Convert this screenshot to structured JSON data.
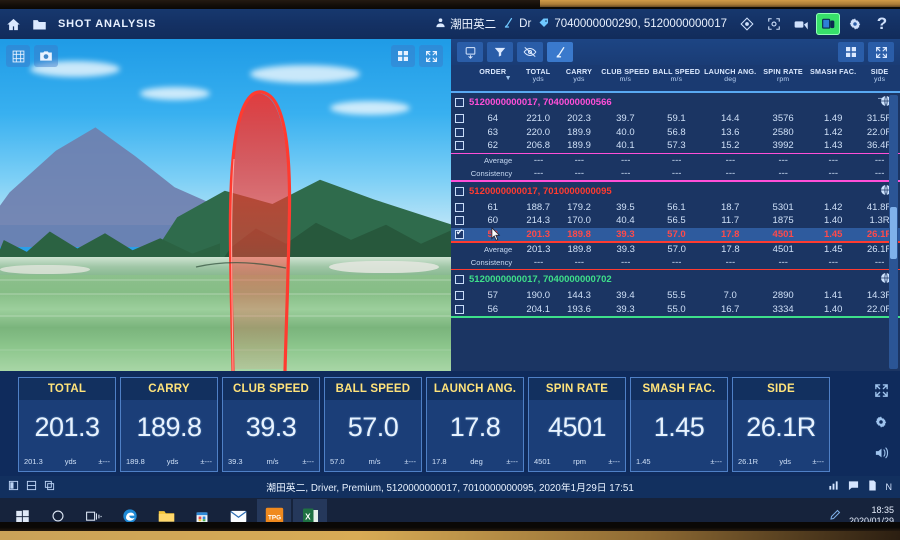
{
  "titlebar": {
    "app_title": "SHOT ANALYSIS",
    "home_icon": "home-icon",
    "folder_icon": "folder-icon",
    "player_icon": "person-icon",
    "player_name": "潮田英二",
    "club_icon": "golf-club-icon",
    "club_name": "Dr",
    "tag_icon": "tag-icon",
    "device_ids": "7040000000290, 5120000000017",
    "right_icons": [
      {
        "name": "calibrate-target-icon",
        "glyph": "target"
      },
      {
        "name": "detect-frame-icon",
        "glyph": "frame"
      },
      {
        "name": "video-camera-icon",
        "glyph": "camera"
      },
      {
        "name": "device-connect-icon",
        "glyph": "device",
        "active": true
      },
      {
        "name": "settings-gear-icon",
        "glyph": "gear"
      },
      {
        "name": "help-icon",
        "glyph": "?"
      }
    ]
  },
  "simulator": {
    "left_tools": [
      {
        "name": "grid-overlay-icon",
        "glyph": "grid"
      },
      {
        "name": "camera-snapshot-icon",
        "glyph": "camera"
      }
    ],
    "right_tools": [
      {
        "name": "layout-grid-icon",
        "glyph": "tiles"
      },
      {
        "name": "fullscreen-icon",
        "glyph": "expand"
      }
    ],
    "trajectory_color": "#ff3b30"
  },
  "toolstrip": [
    {
      "name": "save-shots-button",
      "glyph": "save",
      "selected": false
    },
    {
      "name": "filter-button",
      "glyph": "filter",
      "selected": false
    },
    {
      "name": "hide-shot-button",
      "glyph": "eye-off",
      "selected": false
    },
    {
      "name": "club-filter-button",
      "glyph": "club",
      "selected": true
    },
    {
      "name": "grid-view-button",
      "glyph": "tiles",
      "selected": false
    },
    {
      "name": "expand-table-button",
      "glyph": "expand",
      "selected": false
    }
  ],
  "table": {
    "columns": [
      {
        "label": "ORDER",
        "unit": ""
      },
      {
        "label": "TOTAL",
        "unit": "yds"
      },
      {
        "label": "CARRY",
        "unit": "yds"
      },
      {
        "label": "CLUB SPEED",
        "unit": "m/s"
      },
      {
        "label": "BALL SPEED",
        "unit": "m/s"
      },
      {
        "label": "LAUNCH ANG.",
        "unit": "deg"
      },
      {
        "label": "SPIN RATE",
        "unit": "rpm"
      },
      {
        "label": "SMASH FAC.",
        "unit": ""
      },
      {
        "label": "SIDE",
        "unit": "yds"
      }
    ],
    "sort_caret": "▼",
    "stat_labels": {
      "average": "Average",
      "consistency": "Consistency"
    },
    "empty_value": "---",
    "groups": [
      {
        "title": "5120000000017, 7040000000566",
        "color": "#ff4fd8",
        "rows": [
          {
            "order": "64",
            "total": "221.0",
            "carry": "202.3",
            "club_speed": "39.7",
            "ball_speed": "59.1",
            "launch_angle": "14.4",
            "spin_rate": "3576",
            "smash": "1.49",
            "side": "31.5R",
            "selected": false
          },
          {
            "order": "63",
            "total": "220.0",
            "carry": "189.9",
            "club_speed": "40.0",
            "ball_speed": "56.8",
            "launch_angle": "13.6",
            "spin_rate": "2580",
            "smash": "1.42",
            "side": "22.0R",
            "selected": false
          },
          {
            "order": "62",
            "total": "206.8",
            "carry": "189.9",
            "club_speed": "40.1",
            "ball_speed": "57.3",
            "launch_angle": "15.2",
            "spin_rate": "3992",
            "smash": "1.43",
            "side": "36.4R",
            "selected": false
          }
        ],
        "average": {
          "total": "---",
          "carry": "---",
          "club_speed": "---",
          "ball_speed": "---",
          "launch_angle": "---",
          "spin_rate": "---",
          "smash": "---",
          "side": "---"
        },
        "consistency": {
          "total": "---",
          "carry": "---",
          "club_speed": "---",
          "ball_speed": "---",
          "launch_angle": "---",
          "spin_rate": "---",
          "smash": "---",
          "side": "---"
        }
      },
      {
        "title": "5120000000017, 7010000000095",
        "color": "#ff3b30",
        "rows": [
          {
            "order": "61",
            "total": "188.7",
            "carry": "179.2",
            "club_speed": "39.5",
            "ball_speed": "56.1",
            "launch_angle": "18.7",
            "spin_rate": "5301",
            "smash": "1.42",
            "side": "41.8R",
            "selected": false
          },
          {
            "order": "60",
            "total": "214.3",
            "carry": "170.0",
            "club_speed": "40.4",
            "ball_speed": "56.5",
            "launch_angle": "11.7",
            "spin_rate": "1875",
            "smash": "1.40",
            "side": "1.3R",
            "selected": false
          },
          {
            "order": "59",
            "total": "201.3",
            "carry": "189.8",
            "club_speed": "39.3",
            "ball_speed": "57.0",
            "launch_angle": "17.8",
            "spin_rate": "4501",
            "smash": "1.45",
            "side": "26.1R",
            "selected": true
          }
        ],
        "average": {
          "total": "201.3",
          "carry": "189.8",
          "club_speed": "39.3",
          "ball_speed": "57.0",
          "launch_angle": "17.8",
          "spin_rate": "4501",
          "smash": "1.45",
          "side": "26.1R"
        },
        "consistency": {
          "total": "---",
          "carry": "---",
          "club_speed": "---",
          "ball_speed": "---",
          "launch_angle": "---",
          "spin_rate": "---",
          "smash": "---",
          "side": "---"
        }
      },
      {
        "title": "5120000000017, 7040000000702",
        "color": "#3ee08a",
        "rows": [
          {
            "order": "57",
            "total": "190.0",
            "carry": "144.3",
            "club_speed": "39.4",
            "ball_speed": "55.5",
            "launch_angle": "7.0",
            "spin_rate": "2890",
            "smash": "1.41",
            "side": "14.3R",
            "selected": false
          },
          {
            "order": "56",
            "total": "204.1",
            "carry": "193.6",
            "club_speed": "39.3",
            "ball_speed": "55.0",
            "launch_angle": "16.7",
            "spin_rate": "3334",
            "smash": "1.40",
            "side": "22.0R",
            "selected": false
          }
        ],
        "average": null,
        "consistency": null
      }
    ]
  },
  "metrics": [
    {
      "label": "TOTAL",
      "value": "201.3",
      "sub": "201.3",
      "unit": "yds",
      "tolerance": "±---"
    },
    {
      "label": "CARRY",
      "value": "189.8",
      "sub": "189.8",
      "unit": "yds",
      "tolerance": "±---"
    },
    {
      "label": "CLUB SPEED",
      "value": "39.3",
      "sub": "39.3",
      "unit": "m/s",
      "tolerance": "±---"
    },
    {
      "label": "BALL SPEED",
      "value": "57.0",
      "sub": "57.0",
      "unit": "m/s",
      "tolerance": "±---"
    },
    {
      "label": "LAUNCH ANG.",
      "value": "17.8",
      "sub": "17.8",
      "unit": "deg",
      "tolerance": "±---"
    },
    {
      "label": "SPIN RATE",
      "value": "4501",
      "sub": "4501",
      "unit": "rpm",
      "tolerance": "±---"
    },
    {
      "label": "SMASH FAC.",
      "value": "1.45",
      "sub": "1.45",
      "unit": "",
      "tolerance": "±---"
    },
    {
      "label": "SIDE",
      "value": "26.1R",
      "sub": "26.1R",
      "unit": "yds",
      "tolerance": "±---"
    }
  ],
  "metric_side_tools": [
    {
      "name": "fullscreen-icon"
    },
    {
      "name": "settings-gear-icon"
    },
    {
      "name": "volume-icon"
    }
  ],
  "statusbar": {
    "left_icons": [
      {
        "name": "single-view-icon"
      },
      {
        "name": "split-view-icon"
      },
      {
        "name": "copy-view-icon"
      }
    ],
    "summary": "潮田英二, Driver, Premium, 5120000000017, 7010000000095, 2020年1月29日 17:51",
    "right_icons": [
      {
        "name": "stats-chart-icon"
      },
      {
        "name": "message-icon"
      },
      {
        "name": "document-icon"
      },
      {
        "name": "network-icon",
        "label": "N"
      }
    ]
  },
  "taskbar": {
    "items": [
      {
        "name": "start-button",
        "glyph": "windows"
      },
      {
        "name": "cortana-search-icon",
        "glyph": "circle"
      },
      {
        "name": "task-view-icon",
        "glyph": "taskview"
      },
      {
        "name": "edge-browser-icon",
        "glyph": "e"
      },
      {
        "name": "file-explorer-icon",
        "glyph": "folder"
      },
      {
        "name": "microsoft-store-icon",
        "glyph": "store"
      },
      {
        "name": "mail-icon",
        "glyph": "mail"
      },
      {
        "name": "tpg-app-icon",
        "glyph": "TPG",
        "active": true
      },
      {
        "name": "excel-icon",
        "glyph": "excel",
        "active": true
      }
    ],
    "tray_pen_icon": "pen-icon",
    "clock_time": "18:35",
    "clock_date": "2020/01/29"
  }
}
